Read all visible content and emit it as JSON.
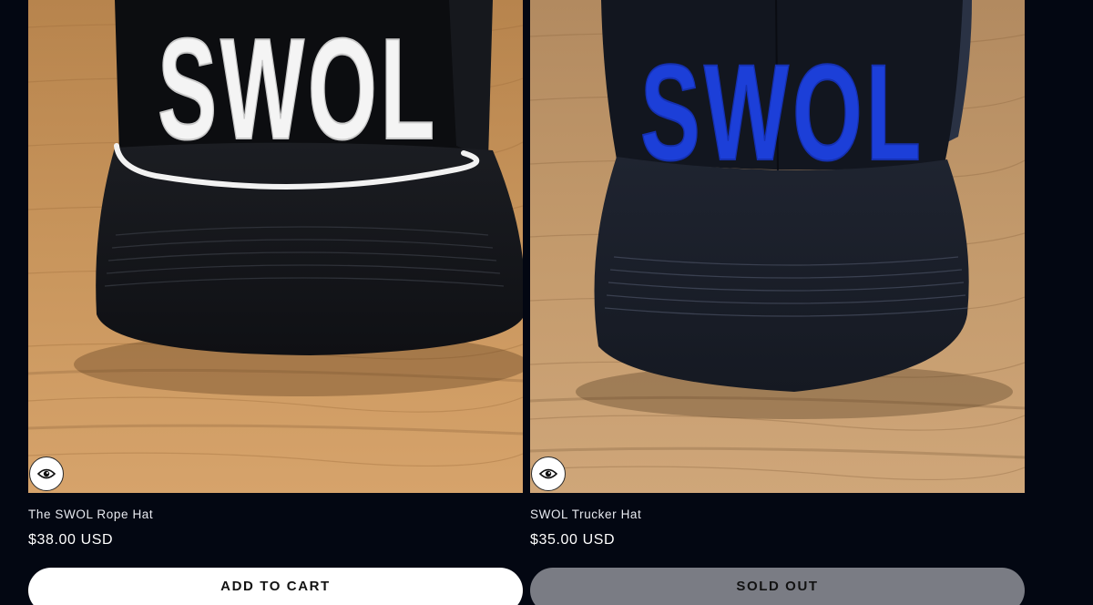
{
  "products": [
    {
      "title": "The SWOL Rope Hat",
      "price": "$38.00 USD",
      "button_label": "ADD TO CART",
      "button_state": "available",
      "hat_text": "SWOL",
      "hat_text_color": "#ffffff",
      "quick_view_icon": "eye-icon"
    },
    {
      "title": "SWOL Trucker Hat",
      "price": "$35.00 USD",
      "button_label": "SOLD OUT",
      "button_state": "sold-out",
      "hat_text": "SWOL",
      "hat_text_color": "#1c3fd8",
      "quick_view_icon": "eye-icon"
    }
  ],
  "colors": {
    "page_background": "#030712",
    "add_to_cart_bg": "#ffffff",
    "sold_out_bg": "#7a7c84"
  }
}
